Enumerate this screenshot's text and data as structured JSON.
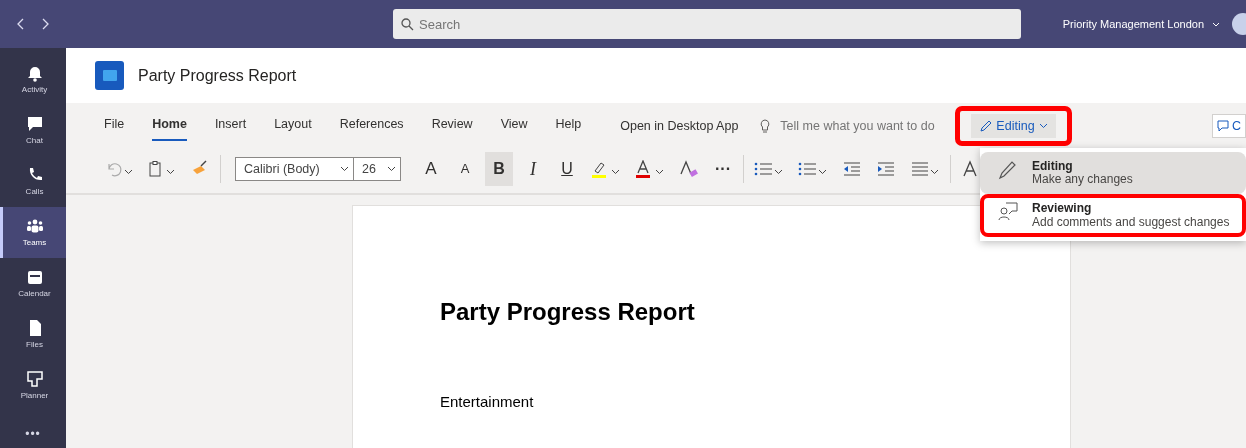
{
  "topbar": {
    "search": {
      "placeholder": "Search"
    },
    "org": "Priority Management London"
  },
  "rail": [
    {
      "label": "Activity",
      "kind": "bell",
      "selected": false
    },
    {
      "label": "Chat",
      "kind": "chat",
      "selected": false
    },
    {
      "label": "Calls",
      "kind": "phone",
      "selected": false
    },
    {
      "label": "Teams",
      "kind": "teams",
      "selected": true
    },
    {
      "label": "Calendar",
      "kind": "calendar",
      "selected": false
    },
    {
      "label": "Files",
      "kind": "file",
      "selected": false
    },
    {
      "label": "Planner",
      "kind": "planner",
      "selected": false
    }
  ],
  "rail_more": "•••",
  "document_title": "Party Progress Report",
  "ribbon_tabs": [
    {
      "label": "File",
      "selected": false
    },
    {
      "label": "Home",
      "selected": true
    },
    {
      "label": "Insert",
      "selected": false
    },
    {
      "label": "Layout",
      "selected": false
    },
    {
      "label": "References",
      "selected": false
    },
    {
      "label": "Review",
      "selected": false
    },
    {
      "label": "View",
      "selected": false
    },
    {
      "label": "Help",
      "selected": false
    }
  ],
  "open_desktop": "Open in Desktop App",
  "tell_me": {
    "placeholder": "Tell me what you want to do"
  },
  "mode_button": {
    "label": "Editing",
    "highlighted": true
  },
  "comment_button": "C",
  "toolbar": {
    "font": "Calibri (Body)",
    "size": "26",
    "bold": "B",
    "italic": "I",
    "underline": "U",
    "grow": "A",
    "shrink": "A",
    "more": "···",
    "bold_active": true
  },
  "mode_menu": [
    {
      "title": "Editing",
      "subtitle": "Make any changes",
      "kind": "pencil",
      "selected": true,
      "highlighted": false
    },
    {
      "title": "Reviewing",
      "subtitle": "Add comments and suggest changes",
      "kind": "reviewer",
      "selected": false,
      "highlighted": true
    }
  ],
  "page": {
    "heading": "Party Progress Report",
    "paragraphs": [
      "Entertainment"
    ]
  }
}
